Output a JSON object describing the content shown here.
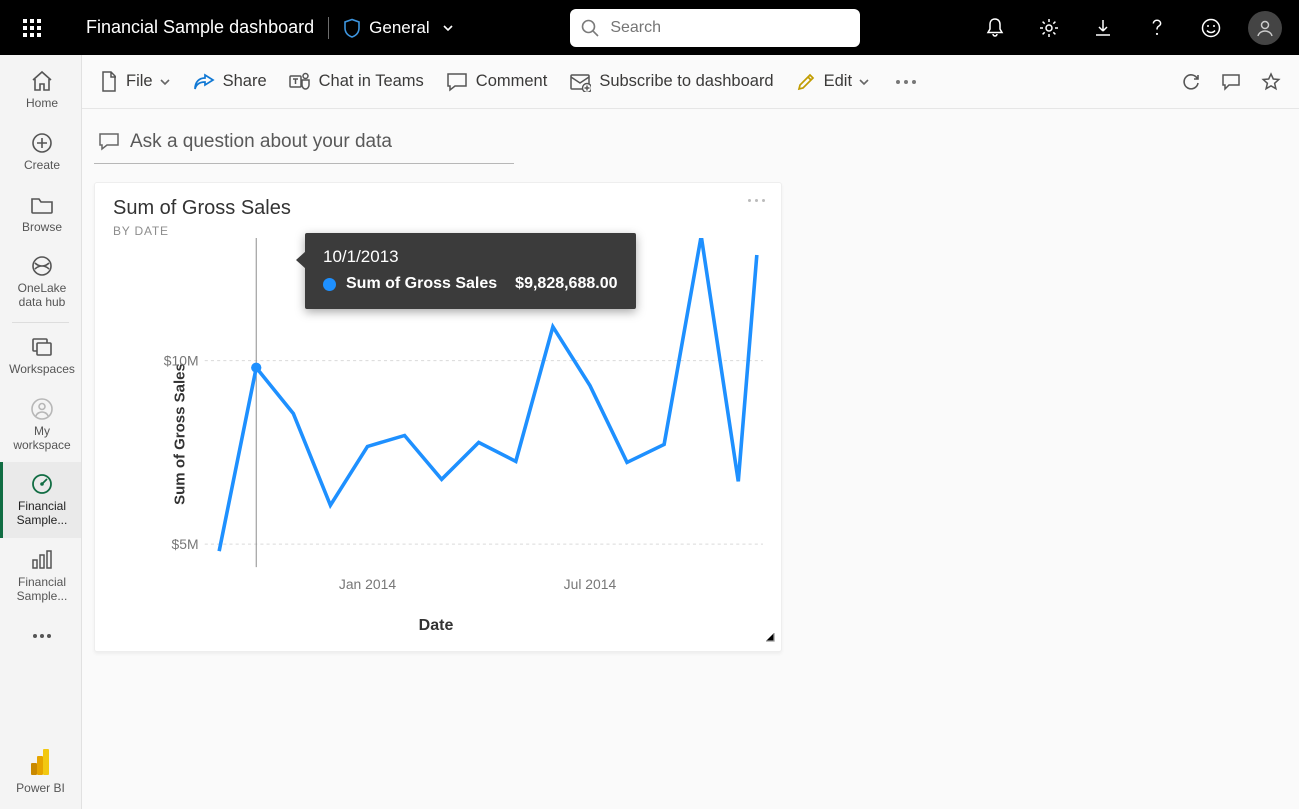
{
  "header": {
    "title": "Financial Sample dashboard",
    "sensitivity_label": "General",
    "search_placeholder": "Search"
  },
  "toolbar": {
    "file": "File",
    "share": "Share",
    "chat_teams": "Chat in Teams",
    "comment": "Comment",
    "subscribe": "Subscribe to dashboard",
    "edit": "Edit"
  },
  "qna_placeholder": "Ask a question about your data",
  "sidebar": {
    "home": "Home",
    "create": "Create",
    "browse": "Browse",
    "onelake": "OneLake data hub",
    "workspaces": "Workspaces",
    "my_workspace": "My workspace",
    "financial_dashboard": "Financial Sample...",
    "financial_report": "Financial Sample...",
    "brand": "Power BI"
  },
  "tile": {
    "title": "Sum of Gross Sales",
    "subtitle": "By Date"
  },
  "axes": {
    "y_label": "Sum of Gross Sales",
    "x_label": "Date",
    "y_ticks": [
      "$5M",
      "$10M"
    ],
    "x_ticks": [
      "Jan 2014",
      "Jul 2014"
    ]
  },
  "tooltip": {
    "date": "10/1/2013",
    "metric": "Sum of Gross Sales",
    "value": "$9,828,688.00"
  },
  "chart_data": {
    "type": "line",
    "title": "Sum of Gross Sales",
    "xlabel": "Date",
    "ylabel": "Sum of Gross Sales",
    "ylim": [
      4000000,
      13000000
    ],
    "x_ticks_shown": [
      "Jan 2014",
      "Jul 2014"
    ],
    "y_ticks_shown": [
      5000000,
      10000000
    ],
    "series": [
      {
        "name": "Sum of Gross Sales",
        "x": [
          "2013-09",
          "2013-10",
          "2013-11",
          "2013-12",
          "2014-01",
          "2014-02",
          "2014-03",
          "2014-04",
          "2014-05",
          "2014-06",
          "2014-07",
          "2014-08",
          "2014-09",
          "2014-10",
          "2014-11",
          "2014-12"
        ],
        "y": [
          4800000,
          9828688,
          8200000,
          5700000,
          7300000,
          7600000,
          6400000,
          7400000,
          6900000,
          10200000,
          8600000,
          6500000,
          7000000,
          12700000,
          6400000,
          12200000
        ]
      }
    ],
    "highlight": {
      "x": "2013-10",
      "y": 9828688
    }
  }
}
